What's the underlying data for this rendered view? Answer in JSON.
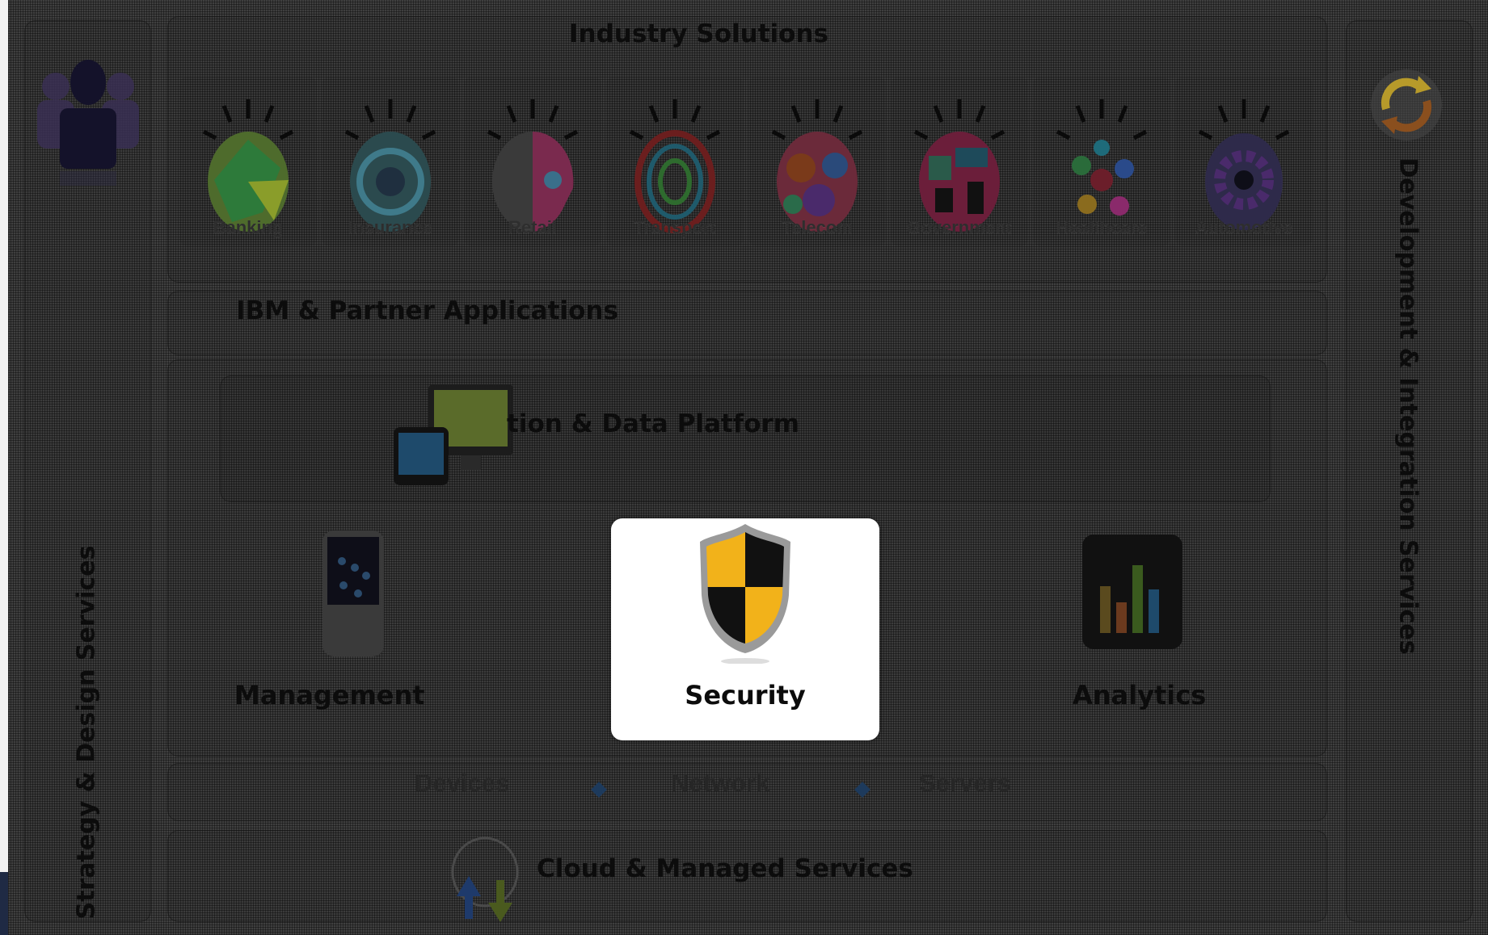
{
  "diagram": {
    "header_title": "Industry Solutions",
    "industries": [
      "Banking",
      "Insurance",
      "Retail",
      "Transport",
      "Telecom",
      "Government",
      "Healthcare",
      "Automotive"
    ],
    "applications_title": "IBM & Partner Applications",
    "platform_title": "tion & Data Platform",
    "capabilities": {
      "management": "Management",
      "security": "Security",
      "analytics": "Analytics"
    },
    "infrastructure": [
      "Devices",
      "Network",
      "Servers"
    ],
    "cloud_title": "Cloud & Managed Services",
    "left_vertical": "Strategy & Design Services",
    "right_vertical": "Development & Integration Services"
  },
  "colors": {
    "background": "#3f3f3f",
    "security_card": "#ffffff",
    "shield_yellow": "#f2b21a",
    "shield_black": "#111111",
    "diamond": "#1d3a5c"
  }
}
